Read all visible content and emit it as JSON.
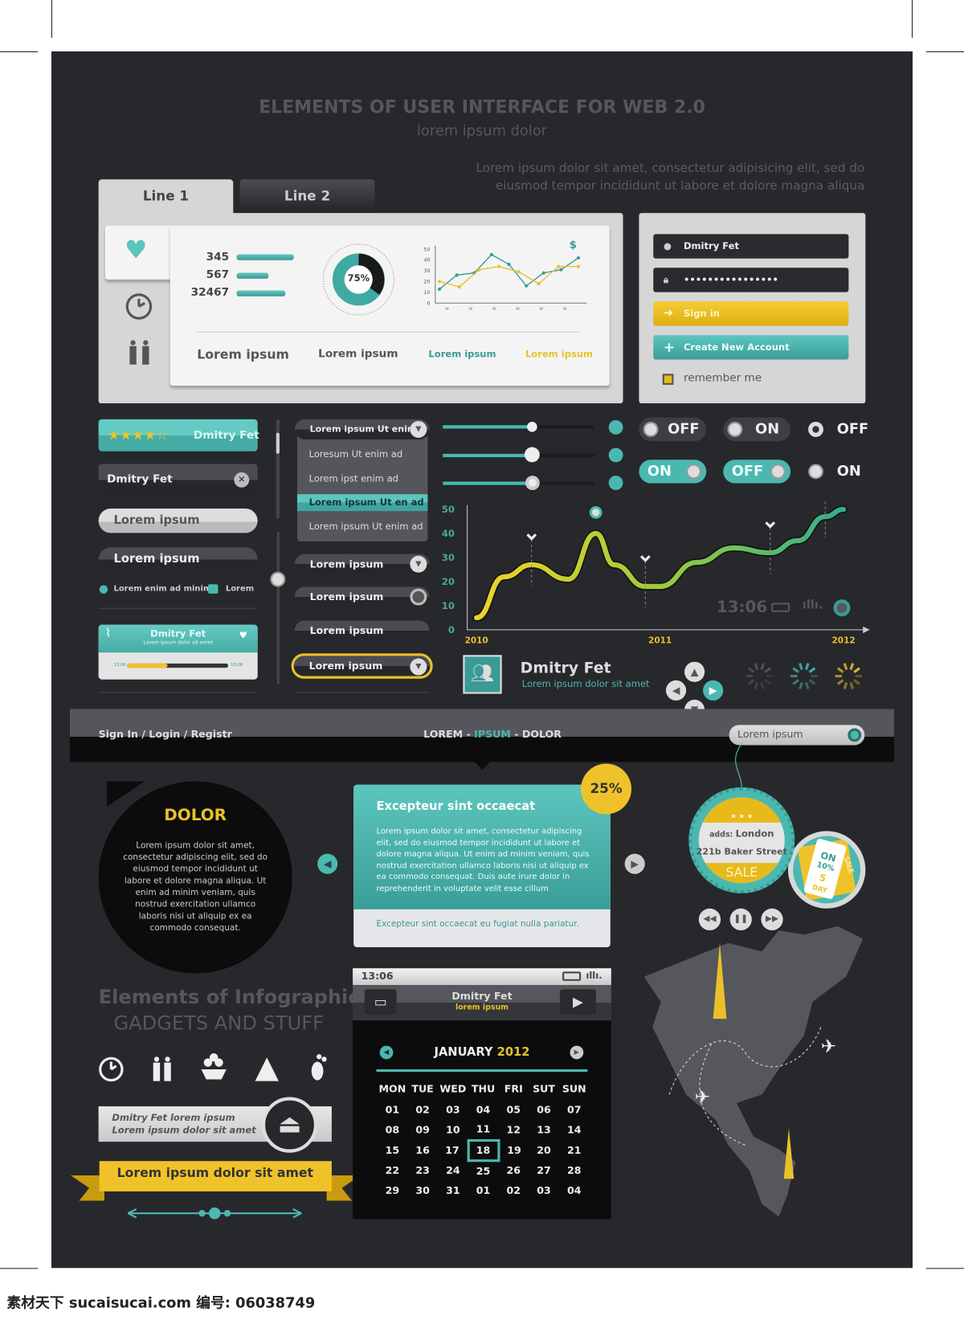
{
  "header": {
    "title": "ELEMENTS OF USER INTERFACE FOR WEB 2.0",
    "subtitle": "lorem ipsum dolor",
    "desc_line1": "Lorem ipsum dolor sit amet, consectetur adipisicing elit, sed do",
    "desc_line2": "eiusmod tempor incididunt ut labore et dolore magna aliqua"
  },
  "tabs": [
    {
      "label": "Line 1",
      "active": true
    },
    {
      "label": "Line 2",
      "active": false
    }
  ],
  "stats": {
    "rows": [
      {
        "value": "345",
        "fill": 0.75
      },
      {
        "value": "567",
        "fill": 0.4
      },
      {
        "value": "32467",
        "fill": 0.63
      }
    ],
    "donut_label": "75%",
    "donut_percent": 75,
    "labels": [
      "Lorem ipsum",
      "Lorem ipsum",
      "Lorem ipsum",
      "Lorem ipsum"
    ],
    "currency_symbol": "$"
  },
  "chart_data": [
    {
      "type": "line",
      "yticks": [
        "0",
        "10",
        "20",
        "30",
        "40",
        "50"
      ],
      "ylim": [
        0,
        50
      ],
      "series": [
        {
          "color": "#3a9a94",
          "values": [
            13,
            26,
            28,
            45,
            36,
            16,
            28,
            31,
            42
          ]
        },
        {
          "color": "#e8c12a",
          "values": [
            20,
            15,
            31,
            34,
            29,
            18,
            34,
            34
          ]
        }
      ]
    },
    {
      "type": "line",
      "yticks": [
        "0",
        "10",
        "20",
        "30",
        "40",
        "50"
      ],
      "ylim": [
        0,
        50
      ],
      "xticks": [
        "2010",
        "2011",
        "2012"
      ],
      "xlim": [
        2010,
        2012
      ],
      "series": [
        {
          "x": [
            2010.0,
            2010.15,
            2010.3,
            2010.5,
            2010.65,
            2010.75,
            2010.92,
            2011.0,
            2011.2,
            2011.4,
            2011.6,
            2011.75,
            2011.9,
            2012.0
          ],
          "y": [
            5,
            22,
            27,
            21,
            40,
            27,
            18,
            18,
            28,
            34,
            32,
            37,
            47,
            50
          ]
        }
      ],
      "status_time": "13:06"
    }
  ],
  "login": {
    "username": "Dmitry Fet",
    "password": "••••••••••••••••",
    "sign_in": "Sign in",
    "create": "Create New Account",
    "remember": "remember me",
    "colors": {
      "yellow": "#f0c22a",
      "teal": "#4bb8b0"
    }
  },
  "left": {
    "rating_name": "Dmitry Fet",
    "rating": 4,
    "rating_max": 5,
    "input_name": "Dmitry Fet",
    "btn_light": "Lorem ipsum",
    "btn_dark": "Lorem ipsum",
    "radio_label": "Lorem enim ad minim",
    "check_label": "Lorem",
    "player_title": "Dmitry Fet",
    "player_sub": "Lorem ipsum dolor sit amet",
    "player_start": "13:06",
    "player_end": "13:06",
    "player_progress": 0.4
  },
  "dropdown": {
    "selected": "Lorem ipsum Ut enim",
    "items": [
      "Loresum Ut enim ad",
      "Lorem ipst enim ad",
      "Lorem ipsum Ut en ad",
      "Lorem ipsum Ut enim ad"
    ],
    "highlighted": 2,
    "buttons": [
      "Lorem ipsum",
      "Lorem ipsum",
      "Lorem ipsum",
      "Lorem ipsum"
    ]
  },
  "sliders": [
    0.6,
    0.6,
    0.6
  ],
  "toggles": [
    {
      "label": "OFF"
    },
    {
      "label": "ON"
    },
    {
      "label": "OFF"
    },
    {
      "label": "ON"
    },
    {
      "label": "OFF"
    },
    {
      "label": "ON"
    }
  ],
  "profile": {
    "name": "Dmitry Fet",
    "sub": "Lorem ipsum dolor sit amet"
  },
  "navbar": {
    "left": "Sign In / Login / Registr",
    "center_a": "LOREM - ",
    "center_b": "IPSUM",
    "center_c": " - DOLOR",
    "search_placeholder": "Lorem ipsum"
  },
  "bubble": {
    "title": "DOLOR",
    "text": "Lorem ipsum dolor sit amet, consectetur adipiscing elit, sed do eiusmod tempor incididunt ut labore et dolore magna aliqua. Ut enim ad minim veniam, quis nostrud exercitation ullamco laboris nisi ut aliquip ex ea commodo consequat."
  },
  "popup": {
    "badge": "25%",
    "title": "Excepteur sint occaecat",
    "body": "Lorem ipsum dolor sit amet, consectetur adipiscing elit, sed do eiusmod tempor incididunt ut labore et dolore magna aliqua. Ut enim ad minim veniam, quis nostrud exercitation ullamco laboris nisi ut aliquip ex ea commodo consequat. Duis aute irure dolor in reprehenderit in voluptate velit esse cillum",
    "footer": "Excepteur sint occaecat eu fugiat nulla pariatur."
  },
  "tag": {
    "adds": "adds: ",
    "city": "London",
    "street": "221b Baker Street",
    "sale": "SALE",
    "small_on": "ON",
    "small_pct": "10%",
    "small_days": "5",
    "small_day": "DAY",
    "small_sale": "SALE"
  },
  "infographics": {
    "title": "Elements of Infographics",
    "subtitle": "GADGETS AND STUFF",
    "eject_line1": "Dmitry Fet lorem ipsum",
    "eject_line2": "Lorem ipsum dolor sit amet",
    "ribbon": "Lorem ipsum dolor sit amet"
  },
  "phone": {
    "time": "13:06",
    "title": "Dmitry Fet",
    "sub": "lorem ipsum"
  },
  "calendar": {
    "month": "JANUARY",
    "year": "2012",
    "days": [
      "MON",
      "TUE",
      "WED",
      "THU",
      "FRI",
      "SUT",
      "SUN"
    ],
    "weeks": [
      [
        "01",
        "02",
        "03",
        "04",
        "05",
        "06",
        "07"
      ],
      [
        "08",
        "09",
        "10",
        "11",
        "12",
        "13",
        "14"
      ],
      [
        "15",
        "16",
        "17",
        "18",
        "19",
        "20",
        "21"
      ],
      [
        "22",
        "23",
        "24",
        "25",
        "26",
        "27",
        "28"
      ],
      [
        "29",
        "30",
        "31",
        "01",
        "02",
        "03",
        "04"
      ]
    ],
    "selected": "18"
  },
  "watermark": "素材天下 sucaisucai.com  编号: 06038749"
}
